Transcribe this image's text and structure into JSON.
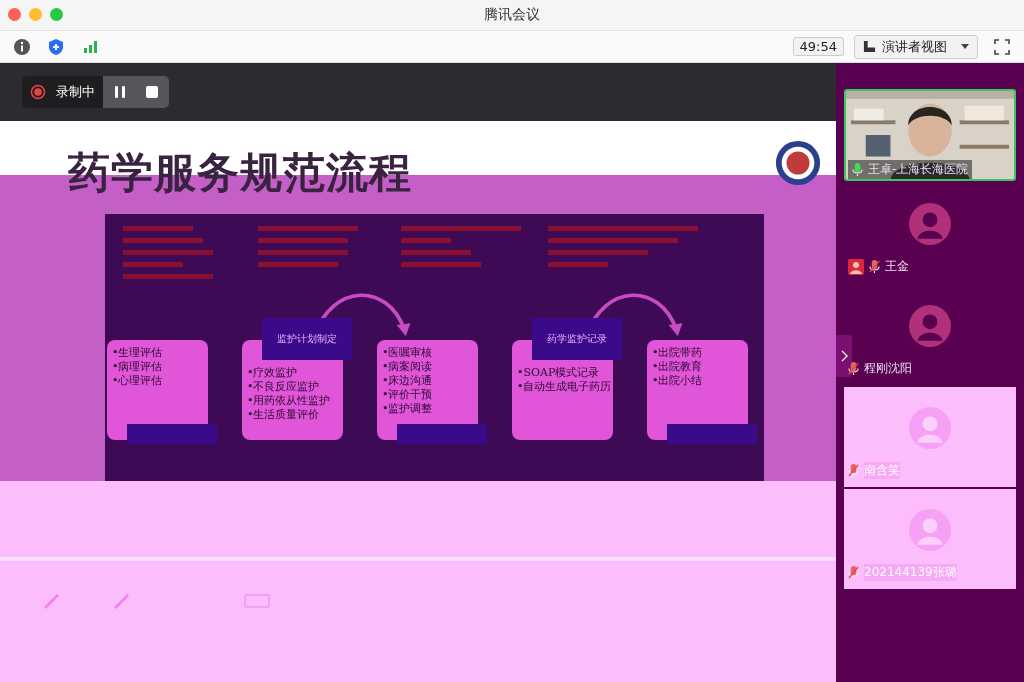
{
  "window": {
    "title": "腾讯会议"
  },
  "toolbar": {
    "timer": "49:54",
    "view_mode": "演讲者视图"
  },
  "recording": {
    "label": "录制中",
    "paused": false
  },
  "slide": {
    "title": "药学服务规范流程",
    "steps": [
      {
        "items": [
          "•生理评估",
          "•病理评估",
          "•心理评估"
        ]
      },
      {
        "header": "监护计划制定",
        "items": [
          "•疗效监护",
          "•不良反应监护",
          "•用药依从性监护",
          "•生活质量评价"
        ]
      },
      {
        "items": [
          "•医嘱审核",
          "•病案阅读",
          "•床边沟通",
          "•评价干预",
          "•监护调整"
        ]
      },
      {
        "header": "药学监护记录",
        "items": [
          "•SOAP模式记录",
          "•自动生成电子药历"
        ]
      },
      {
        "items": [
          "•出院带药",
          "•出院教育",
          "•出院小结"
        ]
      }
    ]
  },
  "participants": [
    {
      "name": "王卓-上海长海医院",
      "kind": "video",
      "muted": false,
      "host": false
    },
    {
      "name": "王金",
      "kind": "avatar",
      "muted": true,
      "host": true
    },
    {
      "name": "程刚沈阳",
      "kind": "avatar",
      "muted": true,
      "host": false
    },
    {
      "name": "南含笑",
      "kind": "avatar",
      "muted": true,
      "host": false
    },
    {
      "name": "202144139张璐",
      "kind": "avatar",
      "muted": true,
      "host": false
    }
  ]
}
